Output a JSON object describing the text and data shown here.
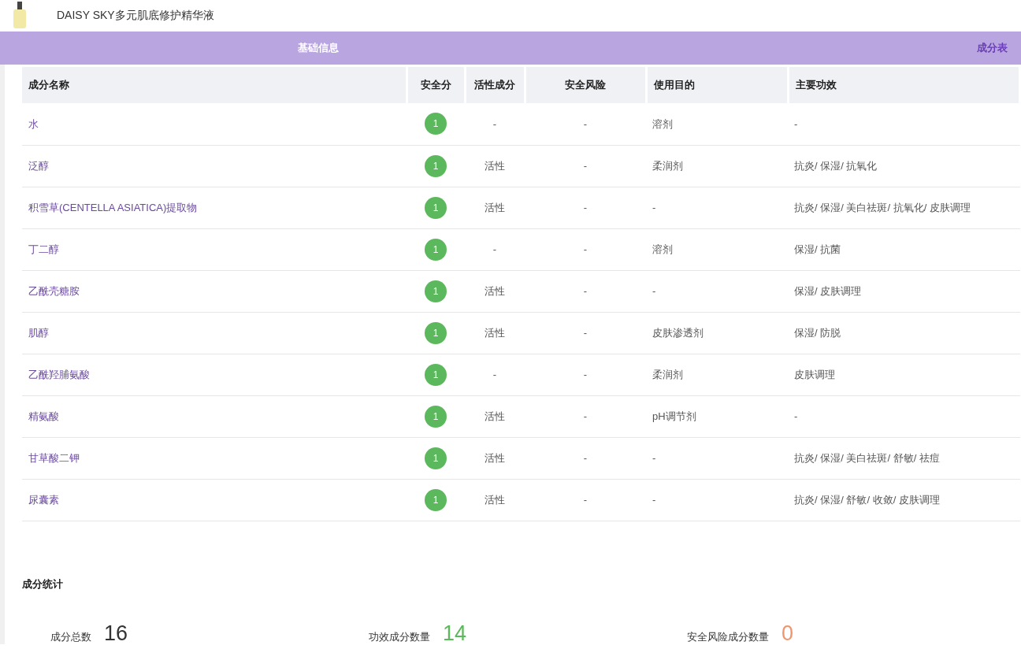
{
  "product": {
    "title": "DAISY SKY多元肌底修护精华液"
  },
  "tabs": [
    {
      "label": "基础信息",
      "selected": false
    },
    {
      "label": "成分表",
      "selected": true
    }
  ],
  "table": {
    "columns": [
      "成分名称",
      "安全分",
      "活性成分",
      "安全风险",
      "使用目的",
      "主要功效"
    ],
    "rows": [
      {
        "name": "水",
        "score": "1",
        "active": "-",
        "risk": "-",
        "purpose": "溶剂",
        "effects": "-"
      },
      {
        "name": "泛醇",
        "score": "1",
        "active": "活性",
        "risk": "-",
        "purpose": "柔润剂",
        "effects": "抗炎/ 保湿/ 抗氧化"
      },
      {
        "name": "积雪草(CENTELLA ASIATICA)提取物",
        "score": "1",
        "active": "活性",
        "risk": "-",
        "purpose": "-",
        "effects": "抗炎/ 保湿/ 美白祛斑/ 抗氧化/ 皮肤调理"
      },
      {
        "name": "丁二醇",
        "score": "1",
        "active": "-",
        "risk": "-",
        "purpose": "溶剂",
        "effects": "保湿/ 抗菌"
      },
      {
        "name": "乙酰壳糖胺",
        "score": "1",
        "active": "活性",
        "risk": "-",
        "purpose": "-",
        "effects": "保湿/ 皮肤调理"
      },
      {
        "name": "肌醇",
        "score": "1",
        "active": "活性",
        "risk": "-",
        "purpose": "皮肤渗透剂",
        "effects": "保湿/ 防脱"
      },
      {
        "name": "乙酰羟脯氨酸",
        "score": "1",
        "active": "-",
        "risk": "-",
        "purpose": "柔润剂",
        "effects": "皮肤调理"
      },
      {
        "name": "精氨酸",
        "score": "1",
        "active": "活性",
        "risk": "-",
        "purpose": "pH调节剂",
        "effects": "-"
      },
      {
        "name": "甘草酸二钾",
        "score": "1",
        "active": "活性",
        "risk": "-",
        "purpose": "-",
        "effects": "抗炎/ 保湿/ 美白祛斑/ 舒敏/ 祛痘"
      },
      {
        "name": "尿囊素",
        "score": "1",
        "active": "活性",
        "risk": "-",
        "purpose": "-",
        "effects": "抗炎/ 保湿/ 舒敏/ 收敛/ 皮肤调理"
      }
    ]
  },
  "stats": {
    "title": "成分统计",
    "items": [
      {
        "label": "成分总数",
        "value": "16",
        "color": "#333333"
      },
      {
        "label": "功效成分数量",
        "value": "14",
        "color": "#5cb85c"
      },
      {
        "label": "安全风险成分数量",
        "value": "0",
        "color": "#f0956e"
      }
    ]
  }
}
